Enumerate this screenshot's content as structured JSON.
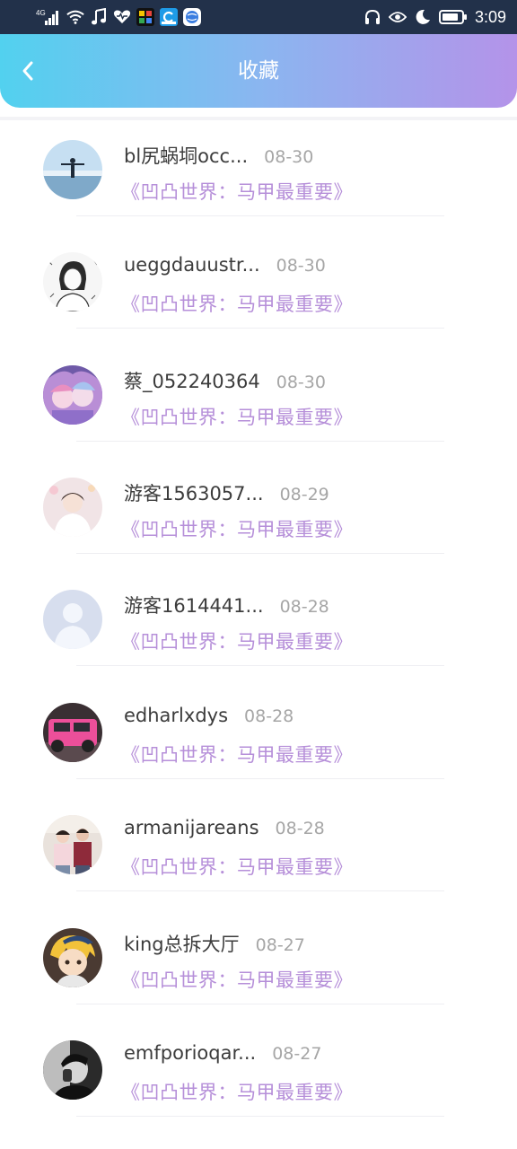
{
  "status_bar": {
    "network": "4G",
    "time": "3:09"
  },
  "header": {
    "title": "收藏",
    "back_icon": "chevron-left-icon"
  },
  "favorites": [
    {
      "name": "bl尻蜗垌occ...",
      "date": "08-30",
      "title": "《凹凸世界：马甲最重要》",
      "avatar": "person-on-coast"
    },
    {
      "name": "ueggdauustr...",
      "date": "08-30",
      "title": "《凹凸世界：马甲最重要》",
      "avatar": "manga-sketch-girl"
    },
    {
      "name": "蔡_052240364",
      "date": "08-30",
      "title": "《凹凸世界：马甲最重要》",
      "avatar": "anime-girls"
    },
    {
      "name": "游客1563057...",
      "date": "08-29",
      "title": "《凹凸世界：马甲最重要》",
      "avatar": "girl-in-white"
    },
    {
      "name": "游客1614441...",
      "date": "08-28",
      "title": "《凹凸世界：马甲最重要》",
      "avatar": "default-avatar"
    },
    {
      "name": "edharlxdys",
      "date": "08-28",
      "title": "《凹凸世界：马甲最重要》",
      "avatar": "pink-suv"
    },
    {
      "name": "armanijareans",
      "date": "08-28",
      "title": "《凹凸世界：马甲最重要》",
      "avatar": "couple-photo"
    },
    {
      "name": "king总拆大厅",
      "date": "08-27",
      "title": "《凹凸世界：马甲最重要》",
      "avatar": "anime-boy-yellow"
    },
    {
      "name": "emfporioqar...",
      "date": "08-27",
      "title": "《凹凸世界：马甲最重要》",
      "avatar": "monochrome-portrait"
    }
  ],
  "colors": {
    "header_gradient_start": "#52d1ef",
    "header_gradient_end": "#b493e9",
    "title_accent": "#b68fd9",
    "date_gray": "#a6a6a6",
    "name_text": "#3c3c3c"
  }
}
